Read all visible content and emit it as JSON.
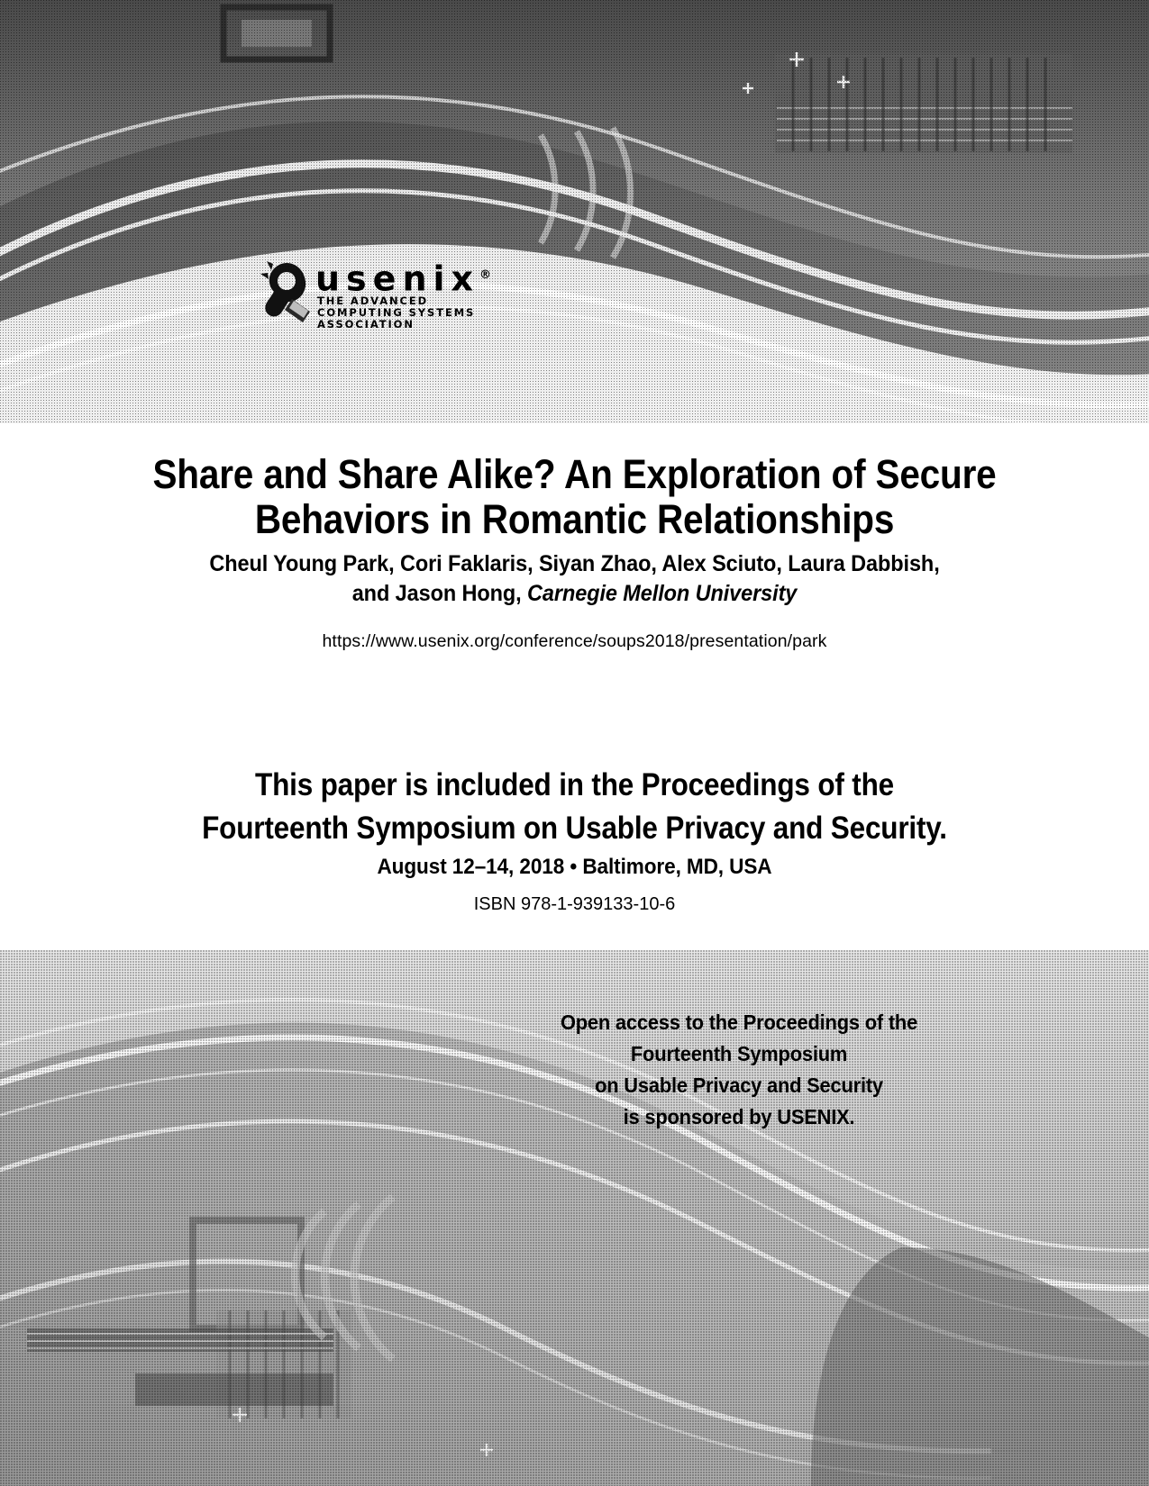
{
  "document": {
    "kind": "conference-proceedings-cover",
    "publisher": "USENIX"
  },
  "logo": {
    "wordmark": "usenix",
    "registered_mark": "®",
    "tagline_line1": "THE ADVANCED",
    "tagline_line2": "COMPUTING SYSTEMS",
    "tagline_line3": "ASSOCIATION",
    "mark_icon": "usenix-gear-mark"
  },
  "paper": {
    "title_line1": "Share and Share Alike? An Exploration of Secure",
    "title_line2": "Behaviors in Romantic Relationships",
    "authors_line1": "Cheul Young Park, Cori Faklaris, Siyan Zhao, Alex Sciuto, Laura Dabbish,",
    "authors_line2_names": "and Jason Hong, ",
    "authors_line2_affiliation": "Carnegie Mellon University",
    "url": "https://www.usenix.org/conference/soups2018/presentation/park"
  },
  "proceedings": {
    "line1": "This paper is included in the Proceedings of the",
    "line2": "Fourteenth Symposium on Usable Privacy and Security.",
    "date_location": "August 12–14, 2018 • Baltimore, MD, USA",
    "isbn": "ISBN 978-1-939133-10-6"
  },
  "sponsor": {
    "line1": "Open access to the Proceedings of the",
    "line2": "Fourteenth Symposium",
    "line3": "on Usable Privacy and Security",
    "line4": "is sponsored by USENIX."
  },
  "colors": {
    "page_background": "#ffffff",
    "text": "#000000",
    "top_band": "#6e6e6e",
    "bottom_band": "#d2d2d2"
  }
}
